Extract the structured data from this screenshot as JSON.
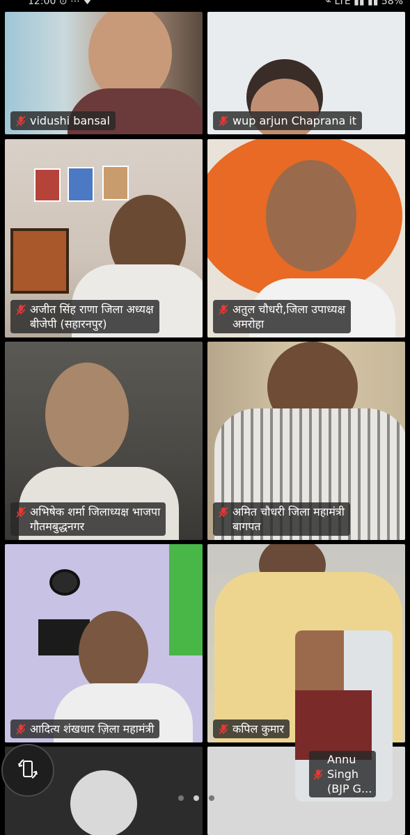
{
  "status_bar": {
    "left": "12:00 ⊙ ⋯ ♥",
    "right": "⌁ LTE ▮▮ ▮▮ 58%"
  },
  "colors": {
    "label_bg": "#282828",
    "mic_muted": "#e53935",
    "bjp_orange": "#e86a24"
  },
  "participants": [
    {
      "name": "vidushi bansal",
      "muted": true
    },
    {
      "name": "wup arjun Chaprana it",
      "muted": true
    },
    {
      "name": "अजीत सिंह राणा जिला अध्यक्ष\nबीजेपी (सहारनपुर)",
      "muted": true
    },
    {
      "name": "अतुल चौधरी,जिला उपाध्यक्ष\nअमरोहा",
      "muted": true
    },
    {
      "name": "अभिषेक शर्मा जिलाध्यक्ष भाजपा\nगौतमबुद्धनगर",
      "muted": true
    },
    {
      "name": "अमित चौधरी जिला महामंत्री\nबागपत",
      "muted": true
    },
    {
      "name": "आदित्य शंखधार ज़िला महामंत्री",
      "muted": true
    },
    {
      "name": "कपिल कुमार",
      "muted": true
    }
  ],
  "self_view": {
    "name": "Annu\nSingh\n(BJP G...",
    "muted": true
  },
  "controls": {
    "rotate_icon": "screen-rotate-icon",
    "page_count": 3,
    "active_page": 1
  }
}
